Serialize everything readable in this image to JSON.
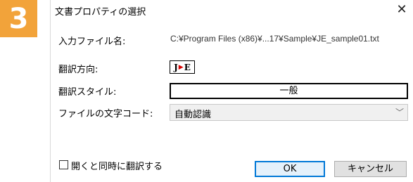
{
  "step_badge": "3",
  "dialog": {
    "title": "文書プロパティの選択",
    "close_glyph": "✕"
  },
  "fields": {
    "input_file_label": "入力ファイル名:",
    "input_file_value": "C:¥Program Files (x86)¥...17¥Sample¥JE_sample01.txt",
    "direction_label": "翻訳方向:",
    "direction_from": "J",
    "direction_to": "E",
    "style_label": "翻訳スタイル:",
    "style_value": "一般",
    "encoding_label": "ファイルの文字コード:",
    "encoding_value": "自動認識"
  },
  "checkbox": {
    "label": "開くと同時に翻訳する",
    "checked": false
  },
  "buttons": {
    "ok": "OK",
    "cancel": "キャンセル"
  },
  "colors": {
    "badge": "#f2a33a",
    "ok_border": "#0078d7",
    "direction_arrow": "#d80000"
  }
}
